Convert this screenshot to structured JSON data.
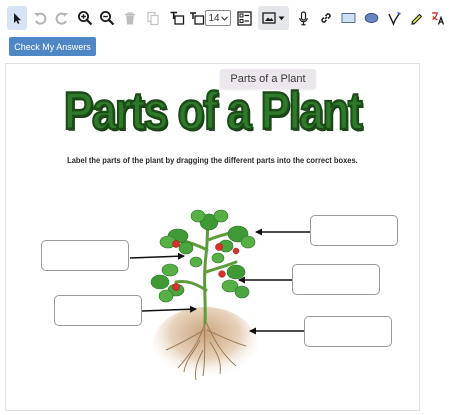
{
  "toolbar": {
    "tools": [
      {
        "name": "select-pointer",
        "icon": "pointer-arrow-icon"
      },
      {
        "name": "undo",
        "icon": "undo-icon"
      },
      {
        "name": "redo",
        "icon": "redo-icon"
      },
      {
        "name": "zoom-in",
        "icon": "zoom-in-icon"
      },
      {
        "name": "zoom-out",
        "icon": "zoom-out-icon"
      },
      {
        "name": "delete",
        "icon": "trash-icon"
      },
      {
        "name": "copy",
        "icon": "copy-icon"
      },
      {
        "name": "text",
        "icon": "text-tool-icon"
      },
      {
        "name": "text-size",
        "icon": "text-size-icon"
      },
      {
        "name": "checkbox-list",
        "icon": "checkbox-list-icon"
      },
      {
        "name": "image",
        "icon": "image-icon"
      },
      {
        "name": "microphone",
        "icon": "microphone-icon"
      },
      {
        "name": "link",
        "icon": "link-icon"
      },
      {
        "name": "rectangle",
        "icon": "rectangle-icon"
      },
      {
        "name": "ellipse",
        "icon": "ellipse-icon"
      },
      {
        "name": "pen",
        "icon": "pen-icon"
      },
      {
        "name": "highlighter",
        "icon": "highlighter-icon"
      },
      {
        "name": "translate",
        "icon": "translate-icon"
      }
    ],
    "font_size_value": "14",
    "check_answers_label": "Check My Answers"
  },
  "tooltip": "Parts of a Plant",
  "worksheet": {
    "title": "Parts of a Plant",
    "instructions": "Label the parts of the plant by dragging the different parts into the correct boxes.",
    "answer_boxes": [
      {
        "name": "answer-box-left-upper",
        "value": ""
      },
      {
        "name": "answer-box-left-lower",
        "value": ""
      },
      {
        "name": "answer-box-right-top",
        "value": ""
      },
      {
        "name": "answer-box-right-middle",
        "value": ""
      },
      {
        "name": "answer-box-right-bottom",
        "value": ""
      }
    ]
  },
  "colors": {
    "accent_button": "#4f87c6",
    "active_tool": "#d6e4f5",
    "title_green": "#2f7a2a",
    "title_outline": "#1b4c17",
    "leaf_green": "#3f9a35",
    "fruit_red": "#d8302a",
    "soil": "#c9a27a"
  }
}
